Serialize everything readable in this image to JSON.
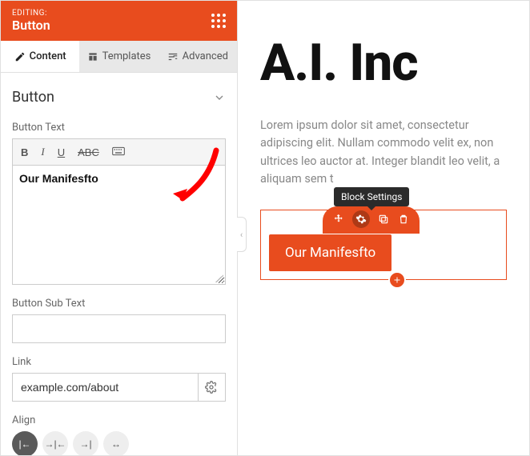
{
  "header": {
    "eyebrow": "EDITING:",
    "title": "Button"
  },
  "tabs": {
    "content": "Content",
    "templates": "Templates",
    "advanced": "Advanced"
  },
  "section": {
    "title": "Button"
  },
  "fields": {
    "button_text_label": "Button Text",
    "button_text_value": "Our Manifesfto",
    "sub_text_label": "Button Sub Text",
    "sub_text_value": "",
    "link_label": "Link",
    "link_value": "example.com/about",
    "align_label": "Align"
  },
  "canvas": {
    "heading": "A.I. Inc",
    "paragraph": "Lorem ipsum dolor sit amet, consectetur adipiscing elit. Nullam commodo velit ex, non ultrices leo auctor at. Integer blandit leo velit, a aliquam sem t",
    "paragraph_trunc": "",
    "tooltip": "Block Settings",
    "button_label": "Our Manifesfto"
  },
  "colors": {
    "accent": "#e84c1e"
  }
}
